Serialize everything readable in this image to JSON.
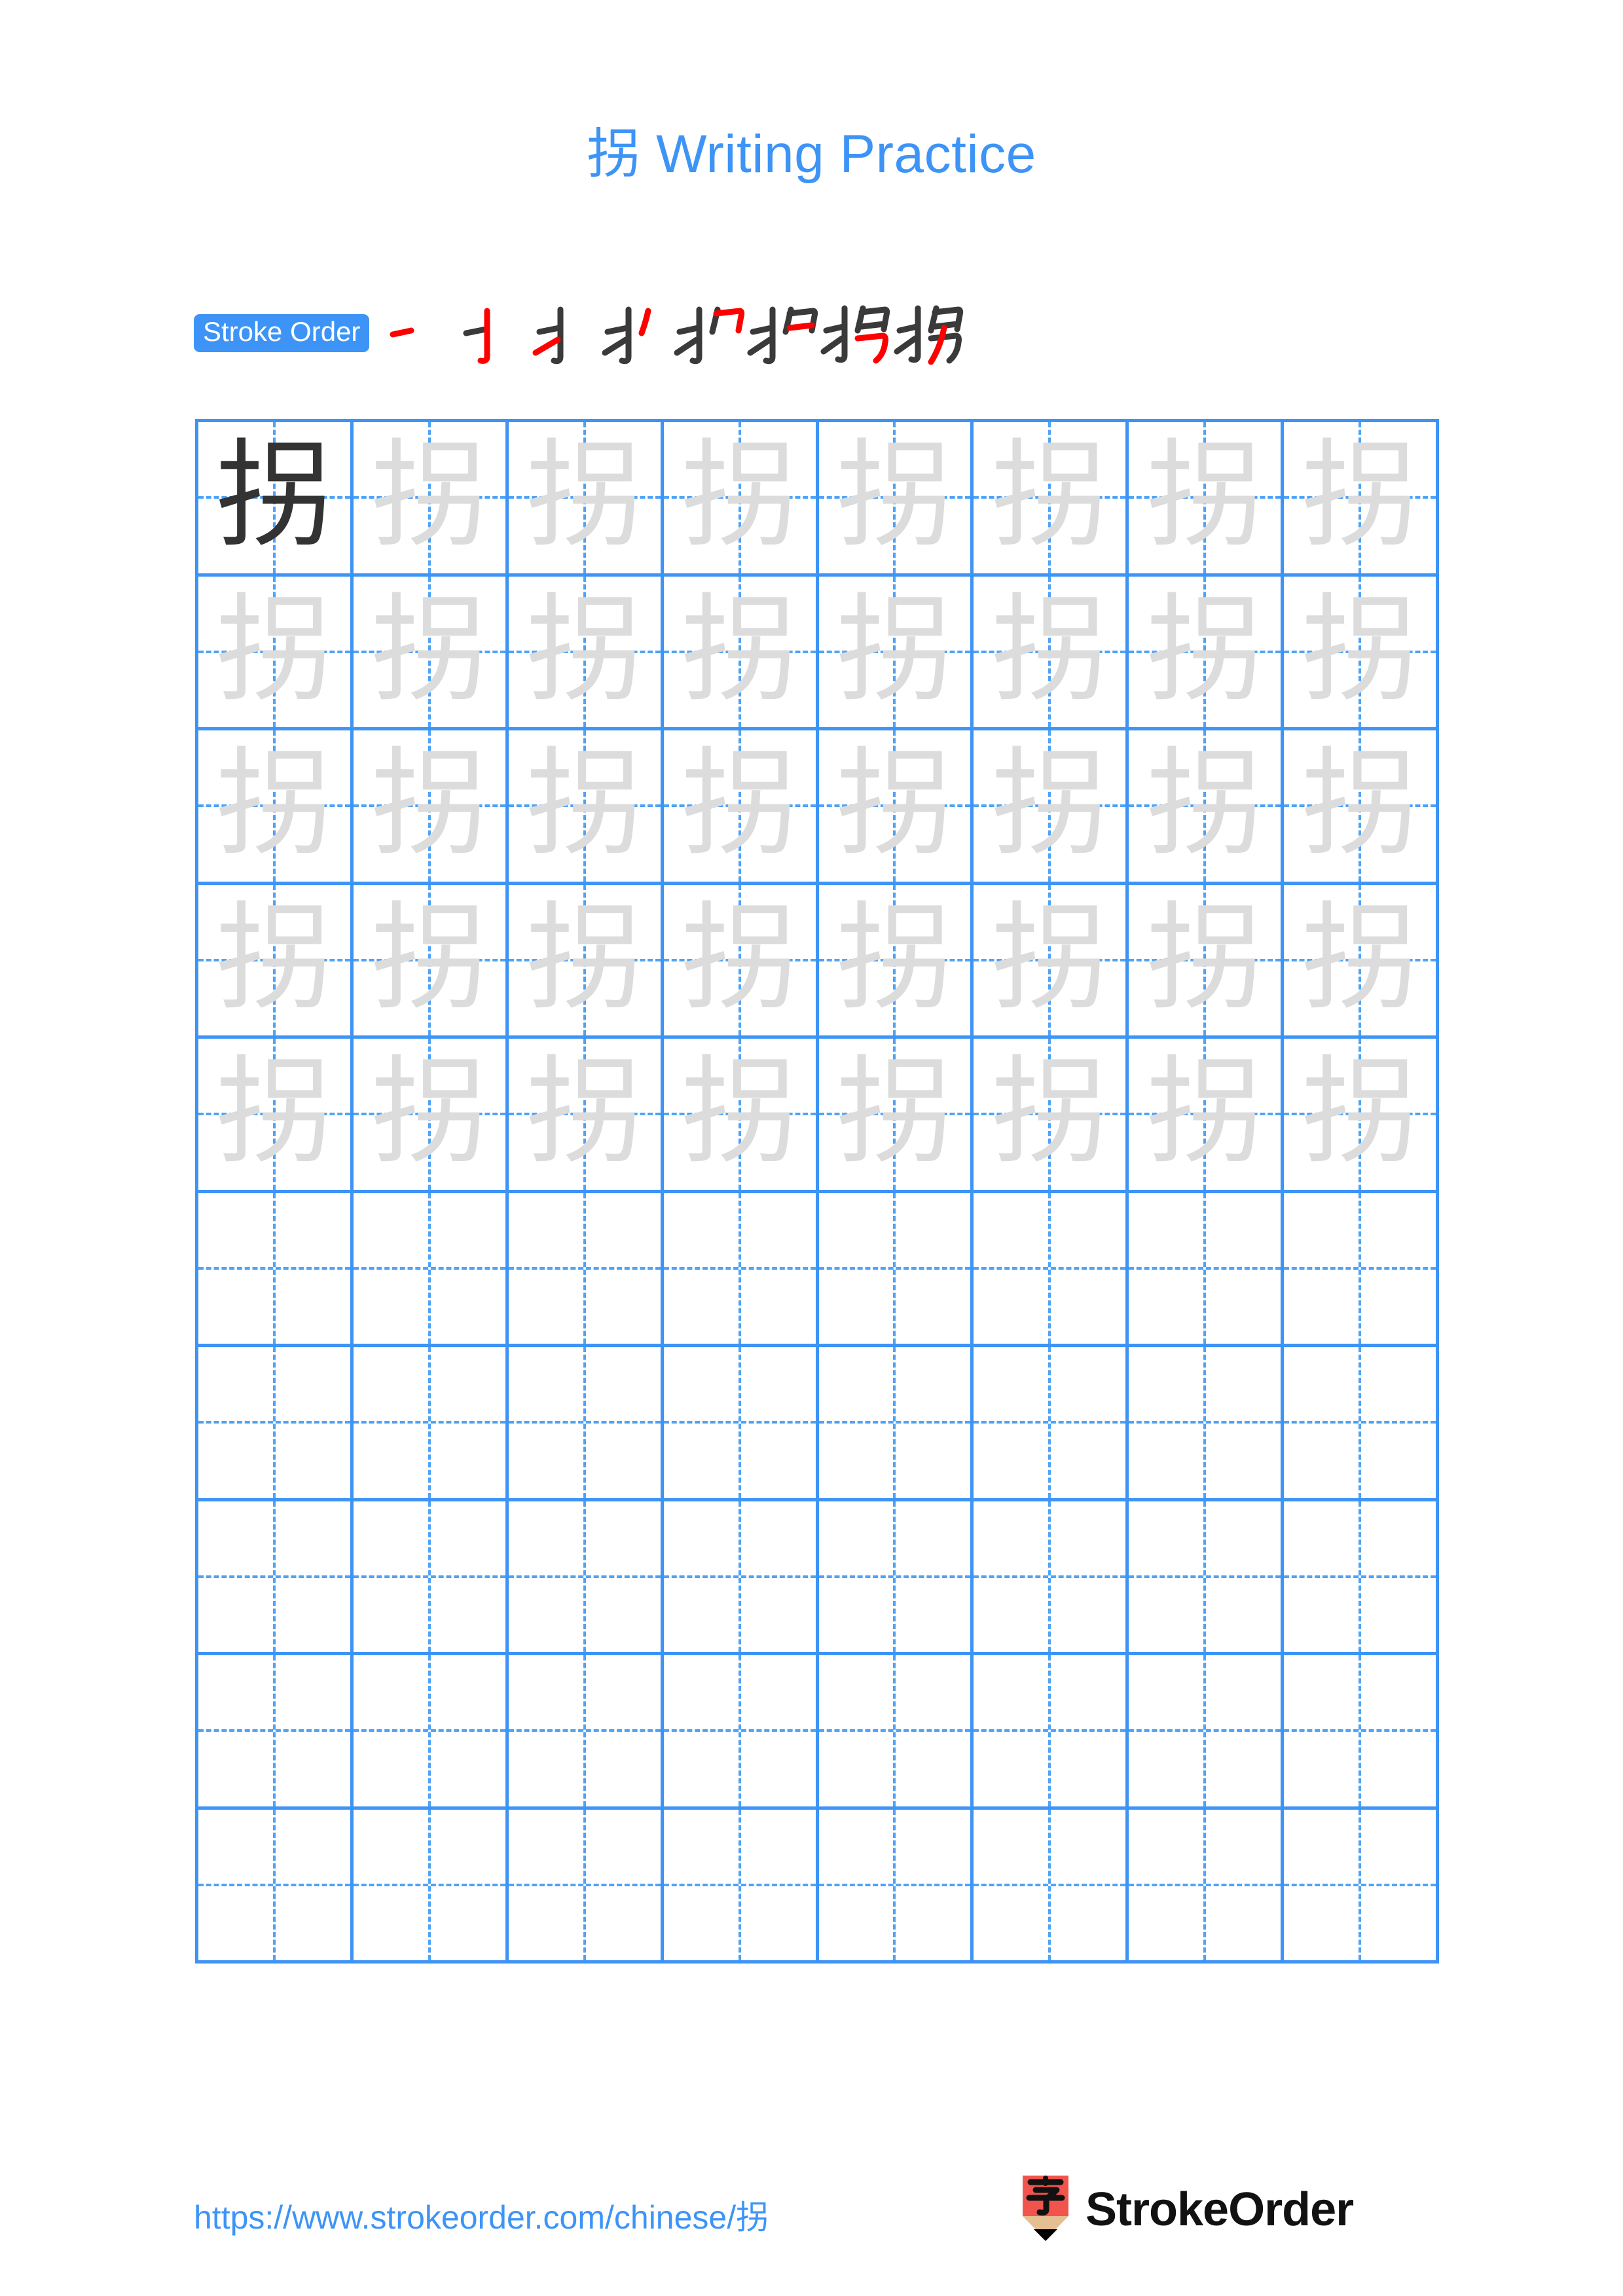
{
  "document": {
    "character": "拐",
    "title": "拐 Writing Practice",
    "type": "chinese-character-writing-practice-worksheet"
  },
  "header": {
    "title": "拐 Writing Practice",
    "title_color": "#3D94F6"
  },
  "stroke_order": {
    "badge_label": "Stroke Order",
    "badge_bg": "#3D94F6",
    "badge_text_color": "#FFFFFF",
    "total_strokes": 8,
    "new_stroke_color": "#FF0000",
    "prior_stroke_color": "#3A3A3A",
    "steps": [
      {
        "index": 1,
        "partial": "一",
        "new_stroke": "heng (horizontal)"
      },
      {
        "index": 2,
        "partial": "亅",
        "new_stroke": "shu-gou (vertical hook)"
      },
      {
        "index": 3,
        "partial": "扌",
        "new_stroke": "ti (rising stroke)"
      },
      {
        "index": 4,
        "partial": "扌丿",
        "new_stroke": "pie (left falling)"
      },
      {
        "index": 5,
        "partial": "扌刁",
        "new_stroke": "heng-zhe-gou (horizontal bend hook)"
      },
      {
        "index": 6,
        "partial": "扌刁",
        "new_stroke": "heng (horizontal inner)"
      },
      {
        "index": 7,
        "partial": "扌召",
        "new_stroke": "heng-zhe (horizontal bend)"
      },
      {
        "index": 8,
        "partial": "拐",
        "new_stroke": "pie (final left falling)"
      }
    ]
  },
  "practice_grid": {
    "columns": 8,
    "rows": 10,
    "grid_line_color": "#3D94F6",
    "guide_line_color": "#4FA3F7",
    "model_char_color": "#333333",
    "trace_char_color": "#DCDCDC",
    "rows_data": [
      {
        "row": 1,
        "cells": [
          {
            "char": "拐",
            "style": "dark"
          },
          {
            "char": "拐",
            "style": "ghost"
          },
          {
            "char": "拐",
            "style": "ghost"
          },
          {
            "char": "拐",
            "style": "ghost"
          },
          {
            "char": "拐",
            "style": "ghost"
          },
          {
            "char": "拐",
            "style": "ghost"
          },
          {
            "char": "拐",
            "style": "ghost"
          },
          {
            "char": "拐",
            "style": "ghost"
          }
        ]
      },
      {
        "row": 2,
        "cells": [
          {
            "char": "拐",
            "style": "ghost"
          },
          {
            "char": "拐",
            "style": "ghost"
          },
          {
            "char": "拐",
            "style": "ghost"
          },
          {
            "char": "拐",
            "style": "ghost"
          },
          {
            "char": "拐",
            "style": "ghost"
          },
          {
            "char": "拐",
            "style": "ghost"
          },
          {
            "char": "拐",
            "style": "ghost"
          },
          {
            "char": "拐",
            "style": "ghost"
          }
        ]
      },
      {
        "row": 3,
        "cells": [
          {
            "char": "拐",
            "style": "ghost"
          },
          {
            "char": "拐",
            "style": "ghost"
          },
          {
            "char": "拐",
            "style": "ghost"
          },
          {
            "char": "拐",
            "style": "ghost"
          },
          {
            "char": "拐",
            "style": "ghost"
          },
          {
            "char": "拐",
            "style": "ghost"
          },
          {
            "char": "拐",
            "style": "ghost"
          },
          {
            "char": "拐",
            "style": "ghost"
          }
        ]
      },
      {
        "row": 4,
        "cells": [
          {
            "char": "拐",
            "style": "ghost"
          },
          {
            "char": "拐",
            "style": "ghost"
          },
          {
            "char": "拐",
            "style": "ghost"
          },
          {
            "char": "拐",
            "style": "ghost"
          },
          {
            "char": "拐",
            "style": "ghost"
          },
          {
            "char": "拐",
            "style": "ghost"
          },
          {
            "char": "拐",
            "style": "ghost"
          },
          {
            "char": "拐",
            "style": "ghost"
          }
        ]
      },
      {
        "row": 5,
        "cells": [
          {
            "char": "拐",
            "style": "ghost"
          },
          {
            "char": "拐",
            "style": "ghost"
          },
          {
            "char": "拐",
            "style": "ghost"
          },
          {
            "char": "拐",
            "style": "ghost"
          },
          {
            "char": "拐",
            "style": "ghost"
          },
          {
            "char": "拐",
            "style": "ghost"
          },
          {
            "char": "拐",
            "style": "ghost"
          },
          {
            "char": "拐",
            "style": "ghost"
          }
        ]
      },
      {
        "row": 6,
        "cells": [
          {
            "char": "",
            "style": "blank"
          },
          {
            "char": "",
            "style": "blank"
          },
          {
            "char": "",
            "style": "blank"
          },
          {
            "char": "",
            "style": "blank"
          },
          {
            "char": "",
            "style": "blank"
          },
          {
            "char": "",
            "style": "blank"
          },
          {
            "char": "",
            "style": "blank"
          },
          {
            "char": "",
            "style": "blank"
          }
        ]
      },
      {
        "row": 7,
        "cells": [
          {
            "char": "",
            "style": "blank"
          },
          {
            "char": "",
            "style": "blank"
          },
          {
            "char": "",
            "style": "blank"
          },
          {
            "char": "",
            "style": "blank"
          },
          {
            "char": "",
            "style": "blank"
          },
          {
            "char": "",
            "style": "blank"
          },
          {
            "char": "",
            "style": "blank"
          },
          {
            "char": "",
            "style": "blank"
          }
        ]
      },
      {
        "row": 8,
        "cells": [
          {
            "char": "",
            "style": "blank"
          },
          {
            "char": "",
            "style": "blank"
          },
          {
            "char": "",
            "style": "blank"
          },
          {
            "char": "",
            "style": "blank"
          },
          {
            "char": "",
            "style": "blank"
          },
          {
            "char": "",
            "style": "blank"
          },
          {
            "char": "",
            "style": "blank"
          },
          {
            "char": "",
            "style": "blank"
          }
        ]
      },
      {
        "row": 9,
        "cells": [
          {
            "char": "",
            "style": "blank"
          },
          {
            "char": "",
            "style": "blank"
          },
          {
            "char": "",
            "style": "blank"
          },
          {
            "char": "",
            "style": "blank"
          },
          {
            "char": "",
            "style": "blank"
          },
          {
            "char": "",
            "style": "blank"
          },
          {
            "char": "",
            "style": "blank"
          },
          {
            "char": "",
            "style": "blank"
          }
        ]
      },
      {
        "row": 10,
        "cells": [
          {
            "char": "",
            "style": "blank"
          },
          {
            "char": "",
            "style": "blank"
          },
          {
            "char": "",
            "style": "blank"
          },
          {
            "char": "",
            "style": "blank"
          },
          {
            "char": "",
            "style": "blank"
          },
          {
            "char": "",
            "style": "blank"
          },
          {
            "char": "",
            "style": "blank"
          },
          {
            "char": "",
            "style": "blank"
          }
        ]
      }
    ]
  },
  "footer": {
    "url": "https://www.strokeorder.com/chinese/拐",
    "url_color": "#3D94F6",
    "logo": {
      "icon_name": "pencil-zi-logo-icon",
      "icon_char": "字",
      "pencil_body_color": "#F1544C",
      "pencil_wood_color": "#E5BE92",
      "pencil_tip_color": "#000000",
      "wordmark": "StrokeOrder",
      "wordmark_color": "#111111"
    }
  }
}
